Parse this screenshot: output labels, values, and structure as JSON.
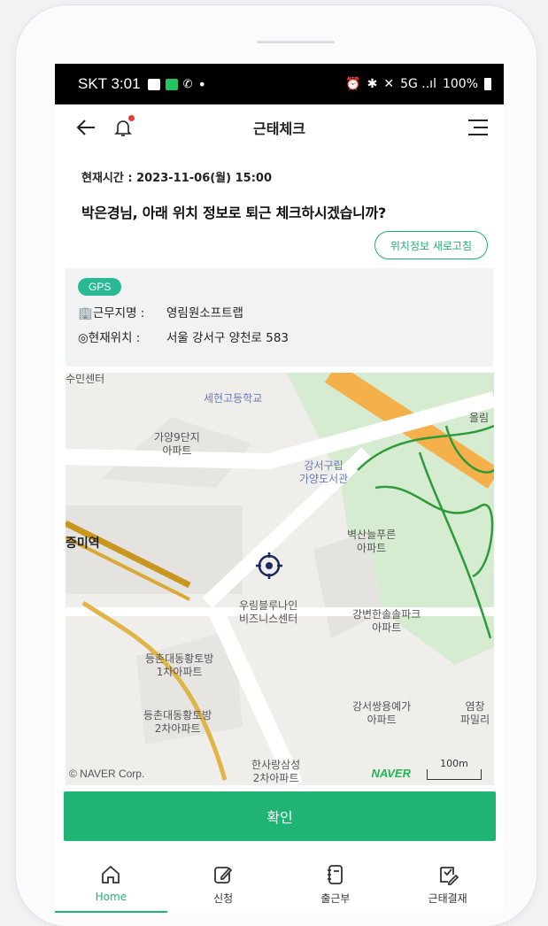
{
  "status_bar": {
    "carrier_time": "SKT 3:01",
    "dot": "•",
    "signal": "5G ..ıl",
    "battery": "100%"
  },
  "header": {
    "title": "근태체크",
    "back_icon": "arrow-left-icon",
    "bell_icon": "bell-icon",
    "menu_icon": "hamburger-menu-icon"
  },
  "info": {
    "current_time": "현재시간 : 2023-11-06(월) 15:00",
    "question": "박은경님, 아래 위치 정보로 퇴근 체크하시겠습니까?",
    "refresh_label": "위치정보 새로고침"
  },
  "location": {
    "badge": "GPS",
    "workplace_label": "근무지명 :",
    "workplace_value": "영림원소프트랩",
    "current_label": "현재위치 :",
    "current_value": "서울 강서구 양천로 583"
  },
  "map": {
    "pois": [
      "수민센터",
      "세현고등학교",
      "가양9단지\n아파트",
      "강서구립\n가양도서관",
      "벽산늘푸른\n아파트",
      "증미역",
      "우림블루나인\n비즈니스센터",
      "강변한솔솔파크\n아파트",
      "등촌대동황토방\n1차아파트",
      "강서쌍용예가\n아파트",
      "등촌대동황토방\n2차아파트",
      "한사랑삼성\n2차아파트",
      "올림",
      "염창\n파밀리"
    ],
    "attribution": "© NAVER Corp.",
    "brand": "NAVER",
    "scale": "100m",
    "colors": {
      "park": "#cfe9c8",
      "road": "#ffffff",
      "subway": "#e3b23a",
      "trail": "#2f9a3a"
    }
  },
  "confirm_label": "확인",
  "nav": [
    {
      "label": "Home",
      "icon": "home-icon",
      "active": true
    },
    {
      "label": "신청",
      "icon": "edit-icon",
      "active": false
    },
    {
      "label": "출근부",
      "icon": "notebook-icon",
      "active": false
    },
    {
      "label": "근태결재",
      "icon": "approval-icon",
      "active": false
    }
  ],
  "accent_color": "#1fb474"
}
